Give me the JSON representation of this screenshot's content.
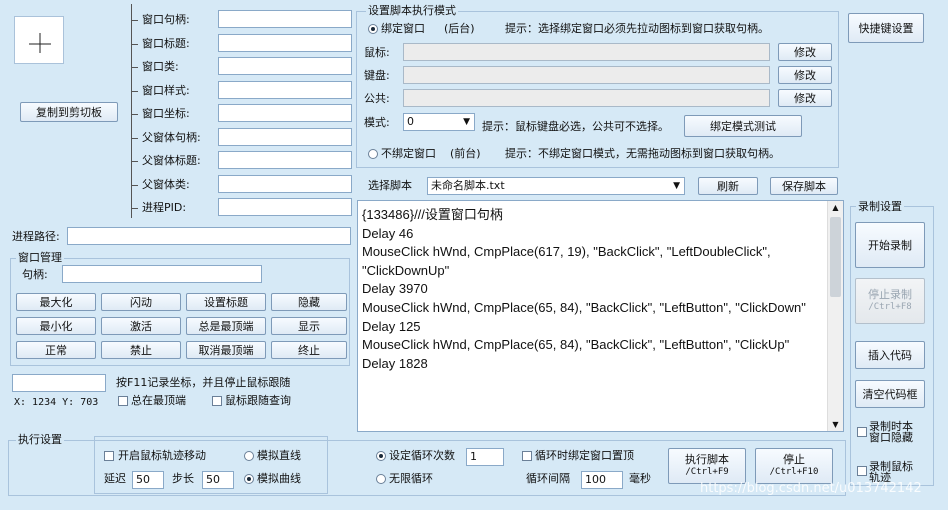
{
  "crosshair_icon": "crosshair-icon",
  "window_info": {
    "copy_button": "复制到剪切板",
    "fields": [
      {
        "label": "窗口句柄:",
        "value": ""
      },
      {
        "label": "窗口标题:",
        "value": ""
      },
      {
        "label": "窗口类:",
        "value": ""
      },
      {
        "label": "窗口样式:",
        "value": ""
      },
      {
        "label": "窗口坐标:",
        "value": ""
      },
      {
        "label": "父窗体句柄:",
        "value": ""
      },
      {
        "label": "父窗体标题:",
        "value": ""
      },
      {
        "label": "父窗体类:",
        "value": ""
      },
      {
        "label": "进程PID:",
        "value": ""
      }
    ],
    "process_path_label": "进程路径:",
    "process_path_value": ""
  },
  "window_mgmt": {
    "title": "窗口管理",
    "handle_label": "句柄:",
    "handle_value": "",
    "buttons": [
      [
        "最大化",
        "闪动",
        "设置标题",
        "隐藏"
      ],
      [
        "最小化",
        "激活",
        "总是最顶端",
        "显示"
      ],
      [
        "正常",
        "禁止",
        "取消最顶端",
        "终止"
      ]
    ],
    "coord_value": "",
    "f11_hint": "按F11记录坐标，并且停止鼠标跟随",
    "xy_readout": "X: 1234  Y: 703",
    "always_top": "总在最顶端",
    "mouse_follow": "鼠标跟随查询"
  },
  "bind_mode": {
    "title": "设置脚本执行模式",
    "bind_radio": "绑定窗口",
    "bind_sub": "(后台)",
    "bind_hint": "提示：选择绑定窗口必须先拉动图标到窗口获取句柄。",
    "mouse_label": "鼠标:",
    "keyboard_label": "键盘:",
    "public_label": "公共:",
    "modify": "修改",
    "mode_label": "模式:",
    "mode_value": "0",
    "mode_hint": "提示：鼠标键盘必选，公共可不选择。",
    "mode_test": "绑定模式测试",
    "unbind_radio": "不绑定窗口",
    "unbind_sub": "(前台)",
    "unbind_hint": "提示：不绑定窗口模式，无需拖动图标到窗口获取句柄。"
  },
  "quick_keys": "快捷键设置",
  "script": {
    "select_label": "选择脚本",
    "selected": "未命名脚本.txt",
    "refresh": "刷新",
    "save": "保存脚本",
    "code": "{133486}///设置窗口句柄\nDelay 46\nMouseClick hWnd, CmpPlace(617, 19), \"BackClick\", \"LeftDoubleClick\", \"ClickDownUp\"\nDelay 3970\nMouseClick hWnd, CmpPlace(65, 84), \"BackClick\", \"LeftButton\", \"ClickDown\"\nDelay 125\nMouseClick hWnd, CmpPlace(65, 84), \"BackClick\", \"LeftButton\", \"ClickUp\"\nDelay 1828"
  },
  "record": {
    "title": "录制设置",
    "start": "开始录制",
    "stop": "停止录制",
    "stop_key": "/Ctrl+F8",
    "insert": "插入代码",
    "clear": "清空代码框",
    "hide_on_record": "录制时本窗口隐藏",
    "record_mouse": "录制鼠标轨迹"
  },
  "exec": {
    "title": "执行设置",
    "track_move": "开启鼠标轨迹移动",
    "straight": "模拟直线",
    "curve": "模拟曲线",
    "delay_label": "延迟",
    "delay_value": "50",
    "step_label": "步长",
    "step_value": "50",
    "loop_count": "设定循环次数",
    "loop_value": "1",
    "infinite": "无限循环",
    "rebind_loop": "循环时绑定窗口置顶",
    "interval_label": "循环间隔",
    "interval_value": "100",
    "ms": "毫秒",
    "run": "执行脚本",
    "run_key": "/Ctrl+F9",
    "stop": "停止",
    "stop_key": "/Ctrl+F10"
  },
  "watermark": "https://blog.csdn.net/u013742142"
}
